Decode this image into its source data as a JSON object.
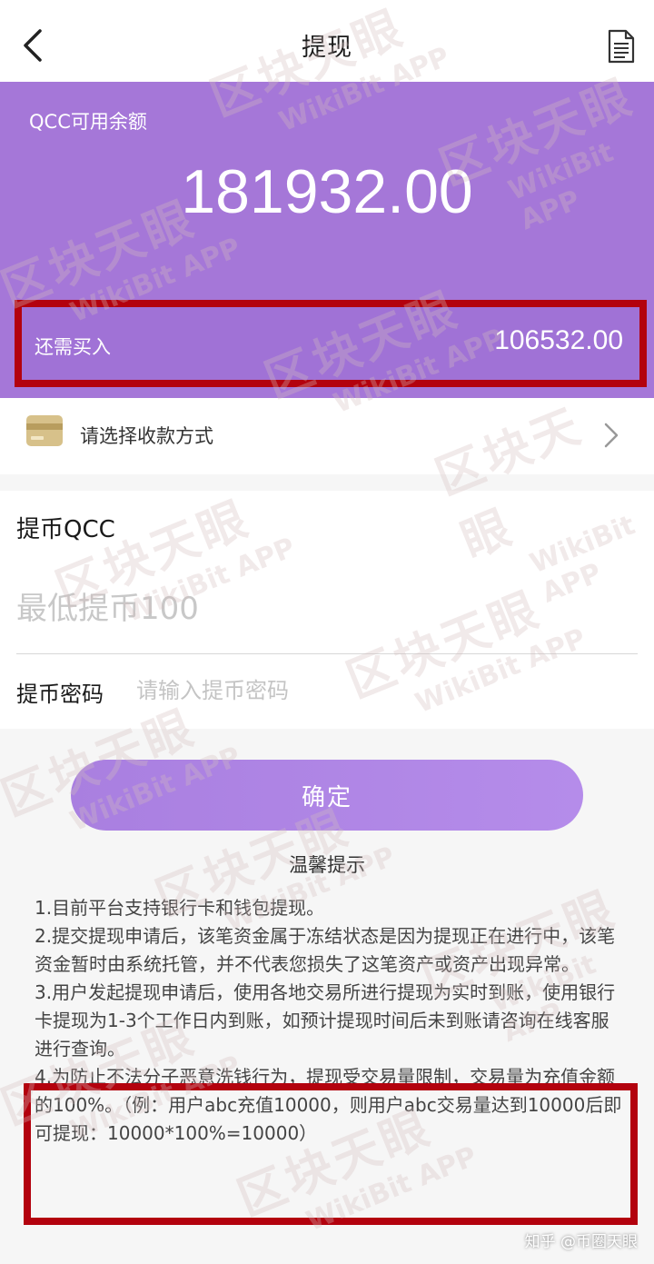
{
  "header": {
    "title": "提现",
    "back_icon": "chevron-left-icon",
    "doc_icon": "document-icon"
  },
  "balance": {
    "label": "QCC可用余额",
    "value": "181932.00",
    "need_buy_label": "还需买入",
    "need_buy_value": "106532.00"
  },
  "payment": {
    "label": "请选择收款方式",
    "icon": "card-icon"
  },
  "form": {
    "qcc_label": "提币QCC",
    "amount_placeholder": "最低提币100",
    "password_label": "提币密码",
    "password_placeholder": "请输入提币密码"
  },
  "confirm_label": "确定",
  "tips": {
    "title": "温馨提示",
    "items": [
      "1.目前平台支持银行卡和钱包提现。",
      "2.提交提现申请后，该笔资金属于冻结状态是因为提现正在进行中，该笔资金暂时由系统托管，并不代表您损失了这笔资产或资产出现异常。",
      "3.用户发起提现申请后，使用各地交易所进行提现为实时到账，使用银行卡提现为1-3个工作日内到账，如预计提现时间后未到账请咨询在线客服进行查询。",
      "4.为防止不法分子恶意洗钱行为，提现受交易量限制，交易量为充值金额的100%。（例：用户abc充值10000，则用户abc交易量达到10000后即可提现：10000*100%=10000）"
    ]
  },
  "watermark": {
    "cn": "区块天眼",
    "en": "WikiBit APP"
  },
  "credit": "知乎 @币圈天眼",
  "colors": {
    "accent": "#a577d8",
    "highlight": "#b3020e"
  }
}
